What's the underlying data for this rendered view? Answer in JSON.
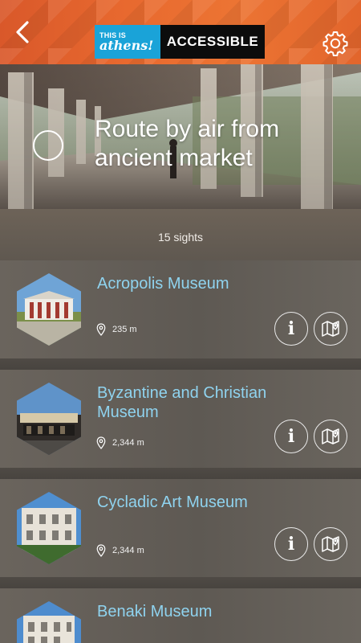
{
  "header": {
    "back_icon": "back-chevron-icon",
    "logo": {
      "this_is": "THIS IS",
      "athens": "athens!",
      "accessible": "ACCESSIBLE"
    },
    "settings_icon": "gear-icon"
  },
  "hero": {
    "title": "Route by air from ancient market",
    "check_icon": "circle-check-icon"
  },
  "summary": {
    "sights_count": "15 sights"
  },
  "sights": [
    {
      "name": "Acropolis Museum",
      "distance": "235 m"
    },
    {
      "name": "Byzantine and Christian Museum",
      "distance": "2,344 m"
    },
    {
      "name": "Cycladic Art Museum",
      "distance": "2,344 m"
    },
    {
      "name": "Benaki Museum",
      "distance": ""
    }
  ],
  "icons": {
    "location": "location-pin-icon",
    "info": "info-icon",
    "map": "map-icon"
  },
  "colors": {
    "header_orange": "#e8692f",
    "logo_blue": "#1aa3d8",
    "title_blue": "#8fd3ef"
  }
}
